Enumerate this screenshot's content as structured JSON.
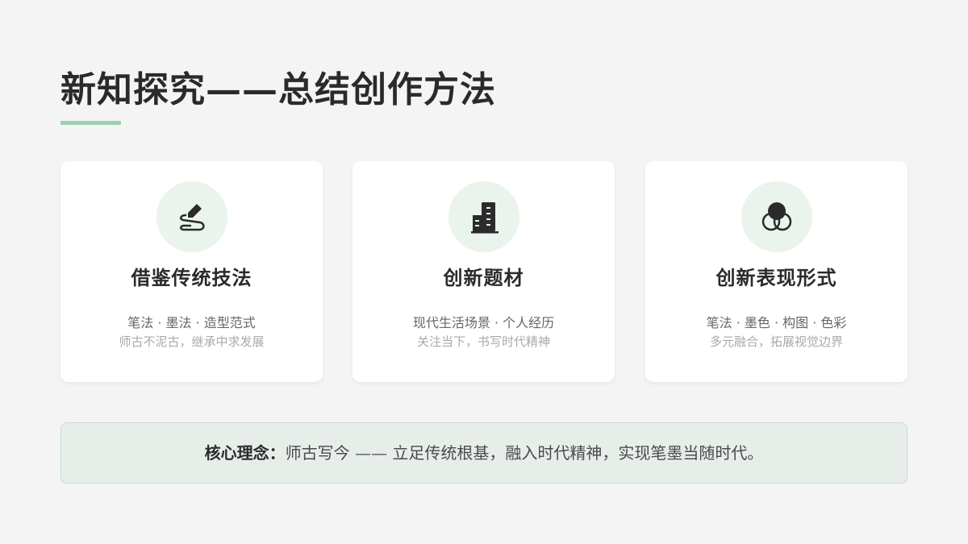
{
  "title": "新知探究——总结创作方法",
  "accent_color": "#9fd0ad",
  "cards": [
    {
      "icon": "brush-stroke-icon",
      "title": "借鉴传统技法",
      "line1": "笔法 · 墨法 · 造型范式",
      "line2": "师古不泥古，继承中求发展"
    },
    {
      "icon": "building-icon",
      "title": "创新题材",
      "line1": "现代生活场景 · 个人经历",
      "line2": "关注当下，书写时代精神"
    },
    {
      "icon": "overlapping-circles-icon",
      "title": "创新表现形式",
      "line1": "笔法 · 墨色 · 构图 · 色彩",
      "line2": "多元融合，拓展视觉边界"
    }
  ],
  "core": {
    "label": "核心理念：",
    "text": "师古写今  ——  立足传统根基，融入时代精神，实现笔墨当随时代。"
  }
}
